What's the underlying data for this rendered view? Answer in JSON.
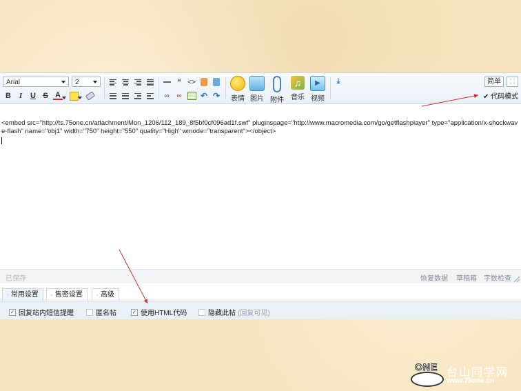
{
  "toolbar": {
    "font": "Arial",
    "size": "2",
    "media": [
      {
        "label": "表情",
        "icon": "smiley-icon"
      },
      {
        "label": "图片",
        "icon": "image-icon"
      },
      {
        "label": "附件",
        "icon": "paperclip-icon"
      },
      {
        "label": "音乐",
        "icon": "music-icon"
      },
      {
        "label": "视频",
        "icon": "video-icon"
      }
    ],
    "simple_label": "简单",
    "code_mode_label": "代码模式",
    "code_mode_checked": true
  },
  "editor": {
    "content": "<embed src=\"http://ts.75one.cn/attachment/Mon_1206/112_189_8f5bf0cf096ad1f.swf\" pluginspage=\"http://www.macromedia.com/go/getflashplayer\" type=\"application/x-shockwave-flash\" name=\"obj1\" width=\"750\" height=\"550\" quality=\"High\" wmode=\"transparent\"></object>"
  },
  "statusbar": {
    "saved": "已保存",
    "restore": "恢复数据",
    "draft": "草稿箱",
    "wordcount": "字数检查"
  },
  "tabs": [
    "常用设置",
    "售密设置",
    "高级"
  ],
  "options": [
    {
      "label": "回复站内短信提醒",
      "checked": true
    },
    {
      "label": "匿名帖",
      "checked": false
    },
    {
      "label": "使用HTML代码",
      "checked": true
    },
    {
      "label": "隐藏此帖",
      "checked": false,
      "note": "(回复可见)"
    }
  ],
  "watermark": {
    "logo_text": "ONE",
    "site_name": "台山同学网",
    "url": "www.75one.cn"
  }
}
